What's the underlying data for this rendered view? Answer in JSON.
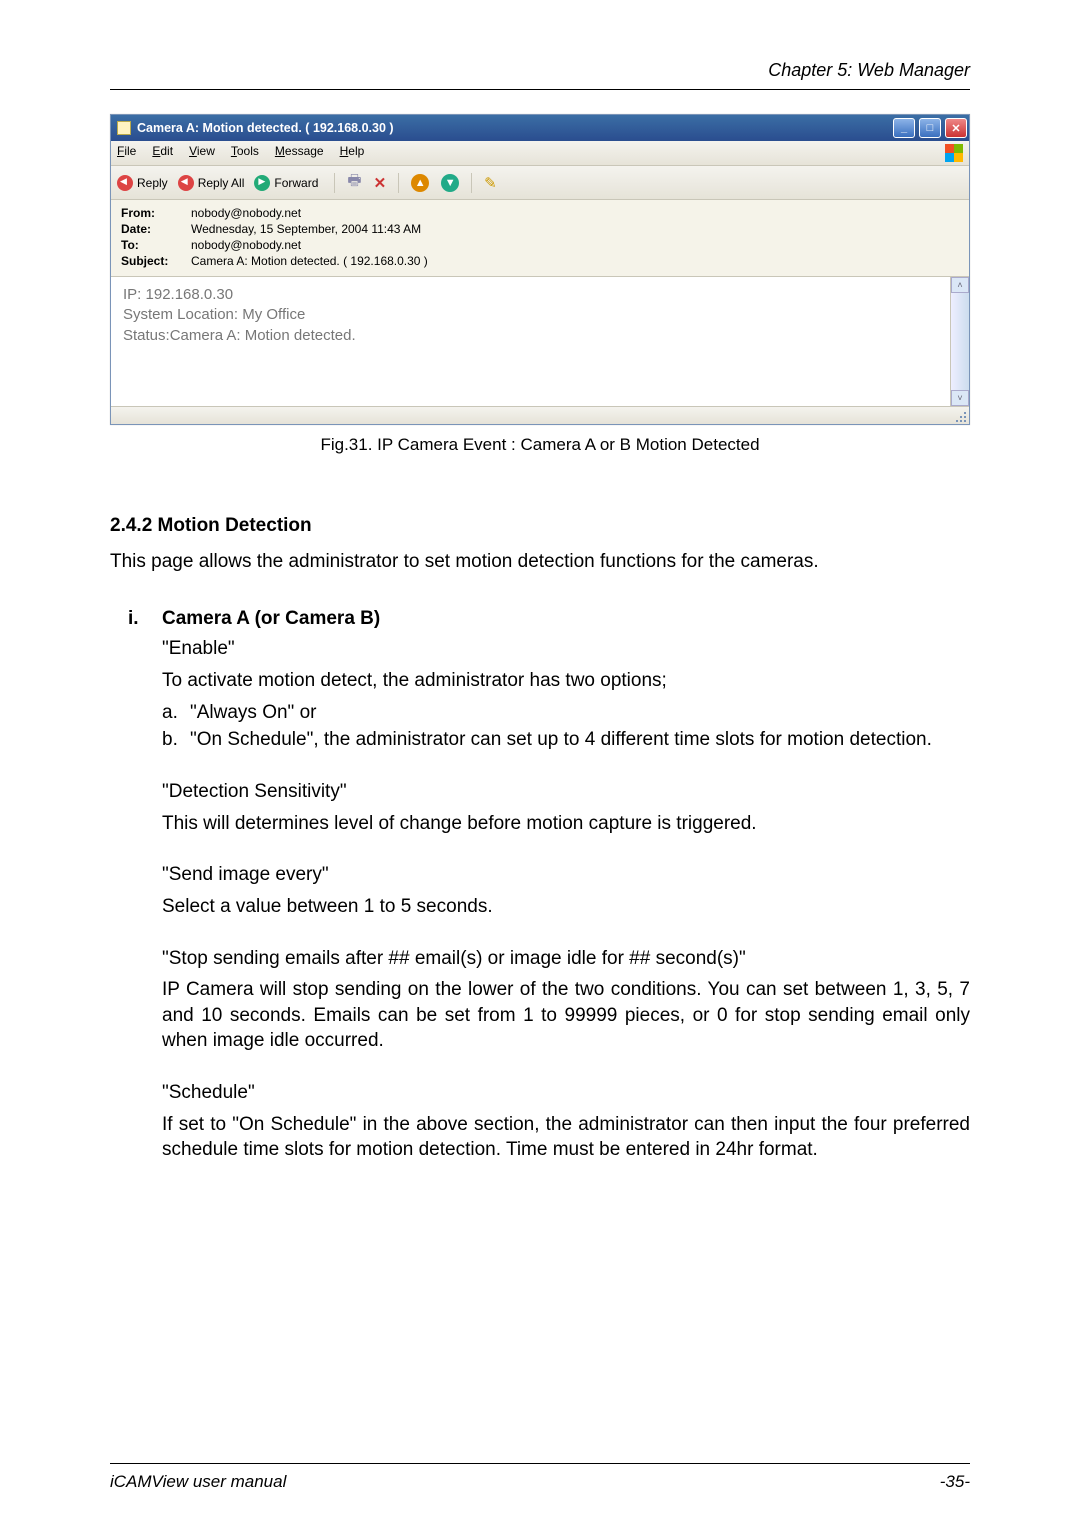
{
  "chapter": "Chapter 5: Web Manager",
  "email": {
    "title": "Camera A: Motion detected. ( 192.168.0.30 )",
    "menus": {
      "file": "File",
      "edit": "Edit",
      "view": "View",
      "tools": "Tools",
      "message": "Message",
      "help": "Help"
    },
    "toolbar": {
      "reply": "Reply",
      "reply_all": "Reply All",
      "forward": "Forward"
    },
    "headers": {
      "from_label": "From:",
      "from_value": "nobody@nobody.net",
      "date_label": "Date:",
      "date_value": "Wednesday, 15 September, 2004 11:43 AM",
      "to_label": "To:",
      "to_value": "nobody@nobody.net",
      "subject_label": "Subject:",
      "subject_value": "Camera A: Motion detected. ( 192.168.0.30 )"
    },
    "body": {
      "line1": "IP: 192.168.0.30",
      "line2": "System Location: My Office",
      "line3": "Status:Camera A: Motion detected."
    }
  },
  "figure_caption": "Fig.31.  IP Camera Event : Camera A or B Motion Detected",
  "section": {
    "heading": "2.4.2 Motion Detection",
    "intro": "This page allows the administrator to set motion detection functions for the cameras."
  },
  "item_i": {
    "marker": "i.",
    "title": "Camera A (or Camera B)",
    "enable_q": "\"Enable\"",
    "enable_desc": "To activate motion detect, the administrator has two options;",
    "opt_a_marker": "a.",
    "opt_a": "\"Always On\" or",
    "opt_b_marker": "b.",
    "opt_b": "\"On Schedule\", the administrator can set up to 4 different time slots for motion detection.",
    "det_q": "\"Detection Sensitivity\"",
    "det_desc": "This will determines level of change before motion capture is triggered.",
    "send_q": "\"Send image every\"",
    "send_desc": "Select a value between 1 to 5 seconds.",
    "stop_q": "\"Stop sending emails after ## email(s) or image idle for ## second(s)\"",
    "stop_desc": "IP Camera will stop sending on the lower of the two conditions.   You can set between 1, 3, 5, 7 and 10 seconds.   Emails can be set from 1 to 99999 pieces, or 0 for stop sending email only when image idle occurred.",
    "sched_q": "\"Schedule\"",
    "sched_desc": "If set to \"On Schedule\" in the above section, the administrator can then input the four preferred schedule time slots for motion detection.   Time must be entered in 24hr format."
  },
  "footer": {
    "left": "iCAMView  user  manual",
    "right": "-35-"
  }
}
